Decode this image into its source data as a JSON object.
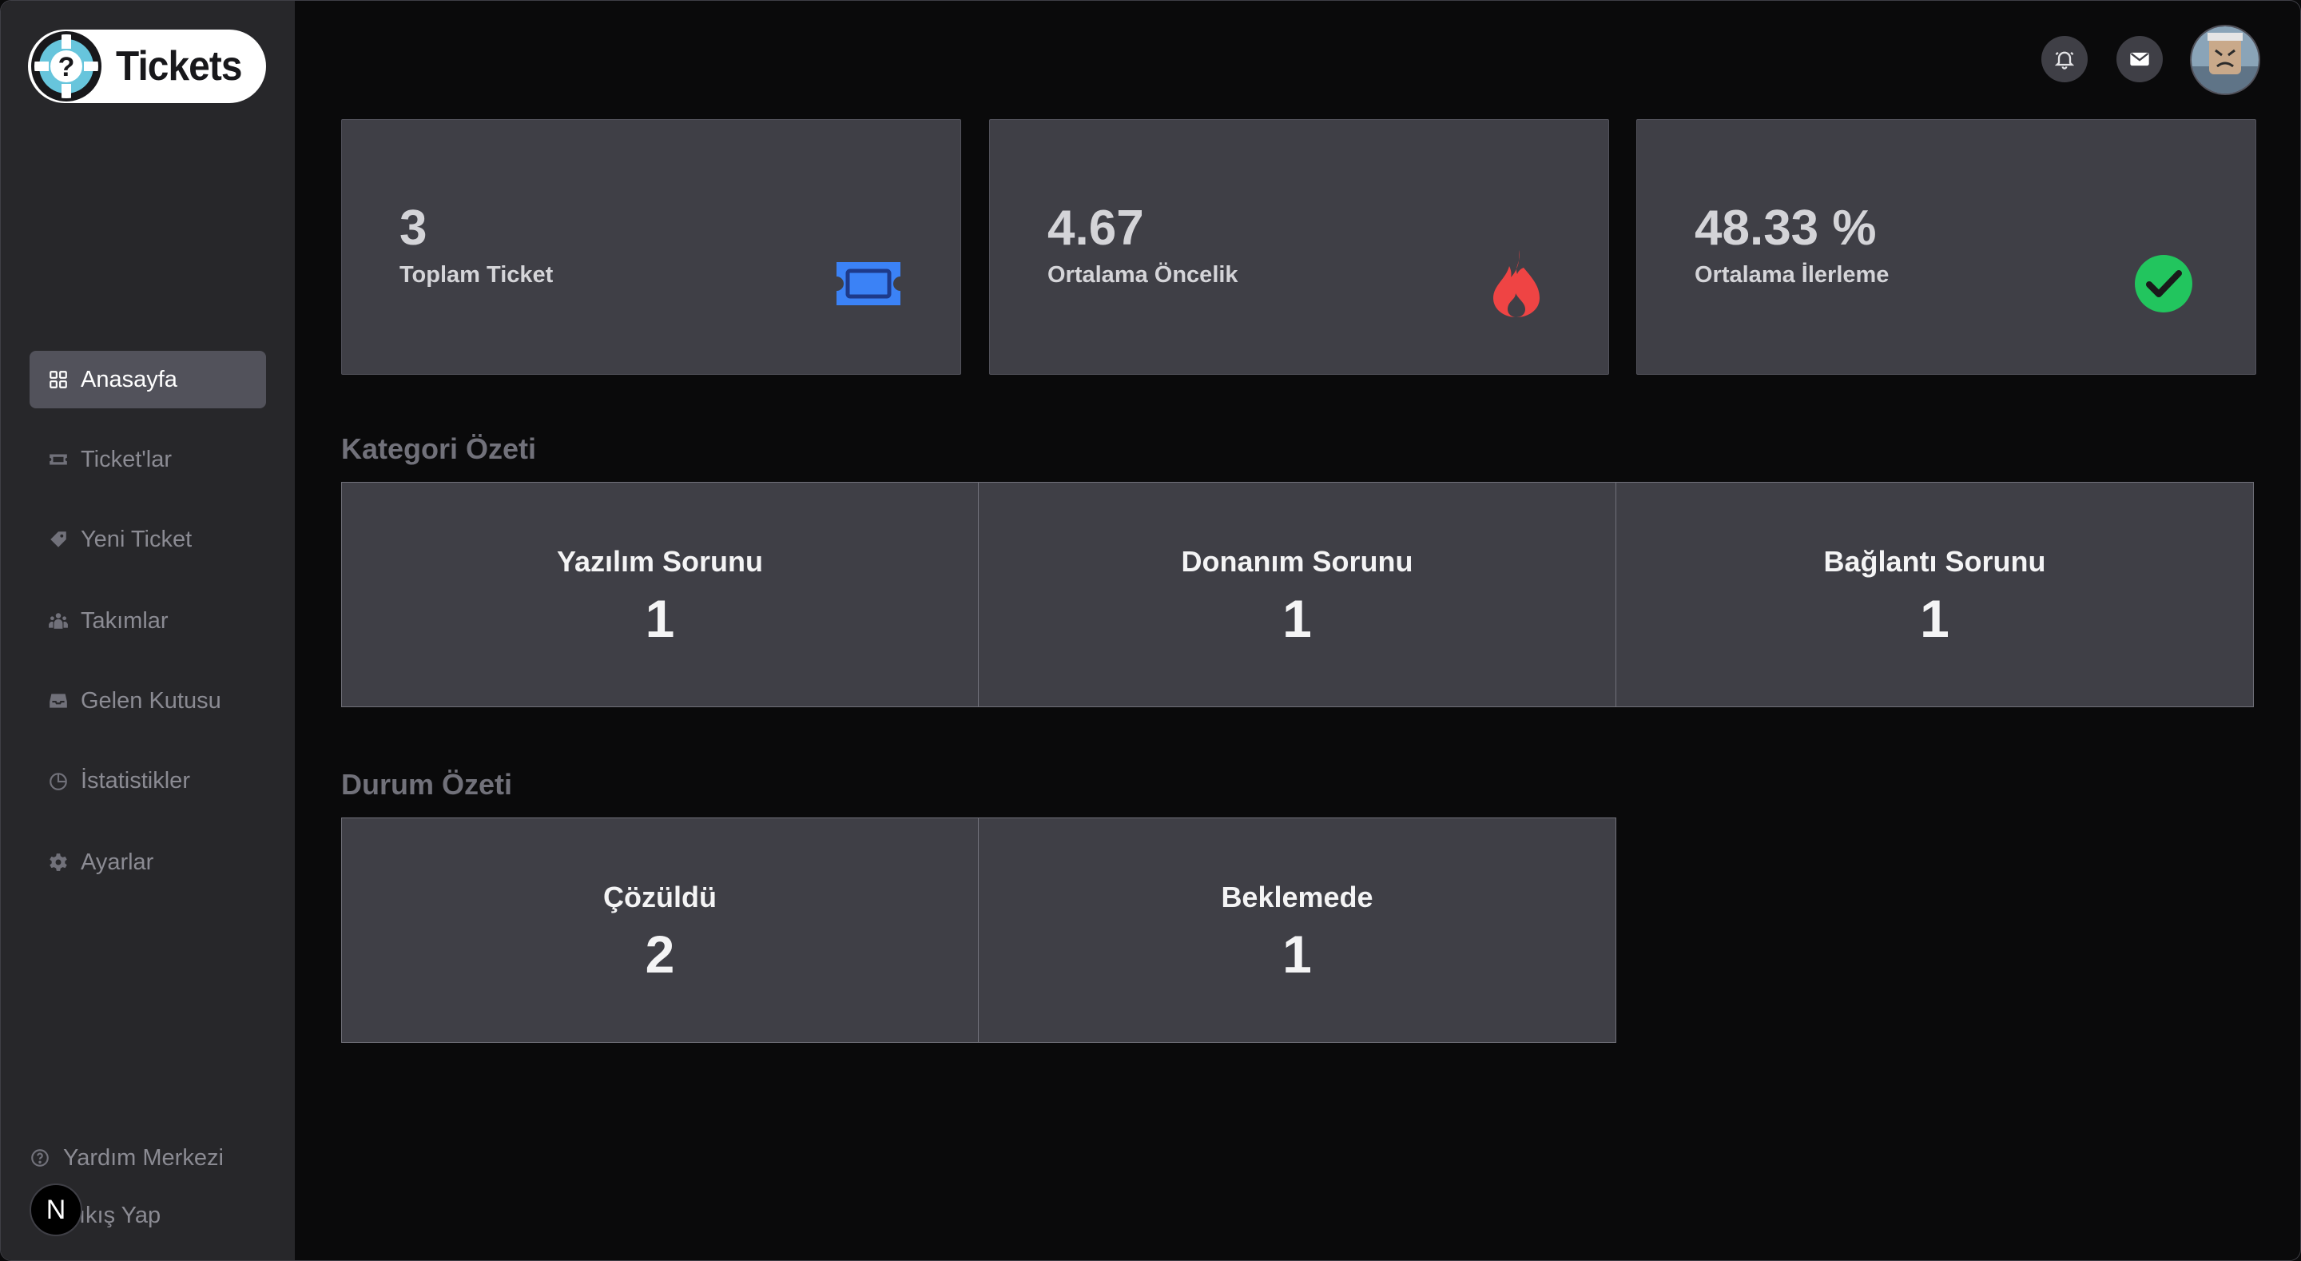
{
  "app": {
    "logo_text": "Tickets"
  },
  "sidebar": {
    "items": [
      {
        "label": "Anasayfa",
        "icon": "grid-icon",
        "active": true
      },
      {
        "label": "Ticket'lar",
        "icon": "ticket-icon",
        "active": false
      },
      {
        "label": "Yeni Ticket",
        "icon": "tag-icon",
        "active": false
      },
      {
        "label": "Takımlar",
        "icon": "team-icon",
        "active": false
      },
      {
        "label": "Gelen Kutusu",
        "icon": "inbox-icon",
        "active": false
      },
      {
        "label": "İstatistikler",
        "icon": "chart-pie-icon",
        "active": false
      },
      {
        "label": "Ayarlar",
        "icon": "gear-icon",
        "active": false
      }
    ],
    "help_label": "Yardım Merkezi",
    "logout_label": "Çıkış Yap",
    "logout_visible_label": "ıkış Yap",
    "dev_badge": "N"
  },
  "header": {
    "notification_icon": "bell-icon",
    "mail_icon": "mail-icon",
    "avatar": "user-avatar"
  },
  "stats": [
    {
      "value": "3",
      "label": "Toplam Ticket",
      "icon": "ticket-icon",
      "color": "#3b82f6"
    },
    {
      "value": "4.67",
      "label": "Ortalama Öncelik",
      "icon": "fire-icon",
      "color": "#ef4444"
    },
    {
      "value": "48.33 %",
      "label": "Ortalama İlerleme",
      "icon": "check-circle-icon",
      "color": "#22c55e"
    }
  ],
  "category_summary": {
    "title": "Kategori Özeti",
    "items": [
      {
        "name": "Yazılım Sorunu",
        "count": "1"
      },
      {
        "name": "Donanım Sorunu",
        "count": "1"
      },
      {
        "name": "Bağlantı Sorunu",
        "count": "1"
      }
    ]
  },
  "status_summary": {
    "title": "Durum Özeti",
    "items": [
      {
        "name": "Çözüldü",
        "count": "2"
      },
      {
        "name": "Beklemede",
        "count": "1"
      }
    ]
  }
}
